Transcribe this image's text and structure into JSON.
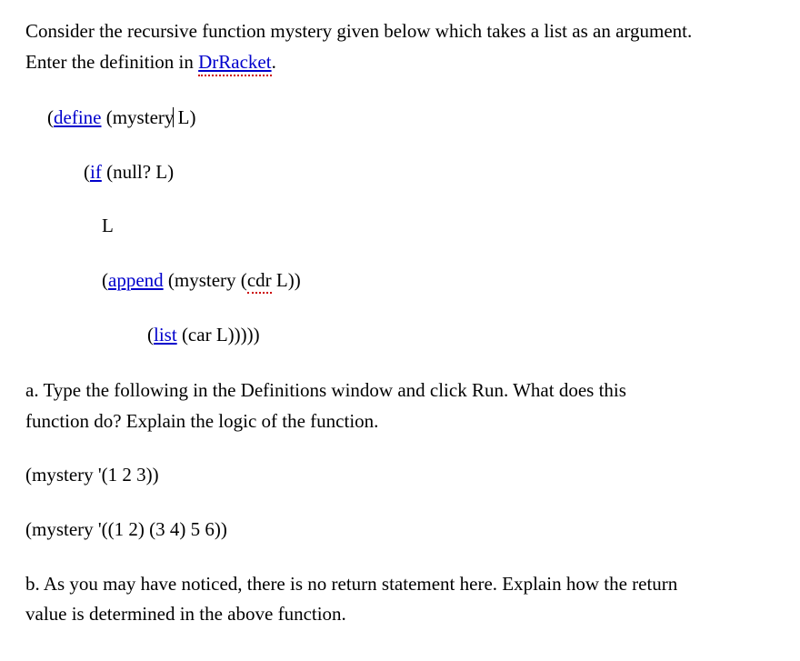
{
  "intro": {
    "line1_part1": "Consider the recursive function mystery given below which takes a list as an argument.",
    "line2_part1": "Enter the definition in ",
    "line2_drracket": "DrRacket",
    "line2_part2": "."
  },
  "code": {
    "line1_paren": "(",
    "line1_define": "define",
    "line1_rest1": " (mystery",
    "line1_rest2": " L)",
    "line2_paren": "(",
    "line2_if": "if",
    "line2_rest": " (null? L)",
    "line3": "L",
    "line4_paren": "(",
    "line4_append": "append",
    "line4_mid": " (mystery (",
    "line4_cdr": "cdr",
    "line4_end": " L))",
    "line5_paren": "(",
    "line5_list": "list",
    "line5_end": " (car L)))))"
  },
  "question_a": {
    "line1": "a. Type the following in the Definitions window and click Run.   What does this",
    "line2": "function do? Explain the logic of the function."
  },
  "expr1": "(mystery '(1 2 3))",
  "expr2": "(mystery '((1 2) (3 4) 5 6))",
  "question_b": {
    "line1": "b. As you may have noticed, there is no return statement here. Explain how the return",
    "line2": "value is determined in the above function."
  }
}
